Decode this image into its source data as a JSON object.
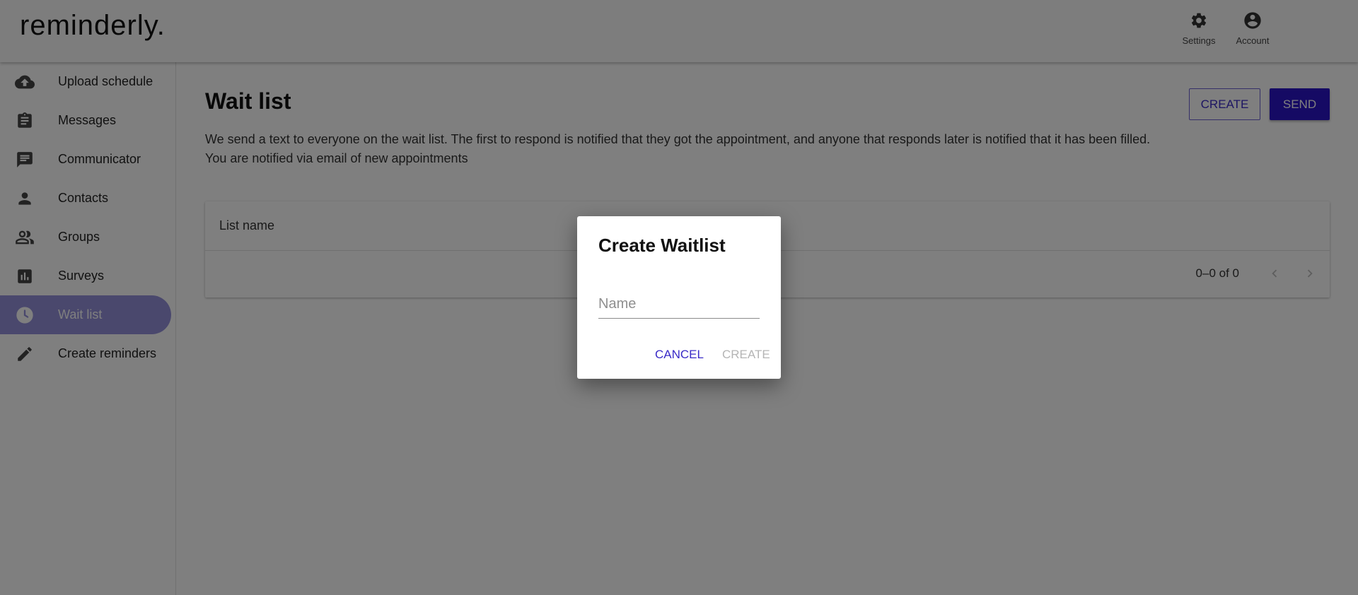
{
  "header": {
    "logo": "reminderly.",
    "actions": [
      {
        "label": "Settings",
        "icon": "gear-icon"
      },
      {
        "label": "Account",
        "icon": "account-circle-icon"
      }
    ]
  },
  "sidebar": {
    "items": [
      {
        "label": "Upload schedule",
        "icon": "cloud-upload-icon",
        "active": false
      },
      {
        "label": "Messages",
        "icon": "clipboard-icon",
        "active": false
      },
      {
        "label": "Communicator",
        "icon": "chat-icon",
        "active": false
      },
      {
        "label": "Contacts",
        "icon": "person-icon",
        "active": false
      },
      {
        "label": "Groups",
        "icon": "people-icon",
        "active": false
      },
      {
        "label": "Surveys",
        "icon": "bar-chart-icon",
        "active": false
      },
      {
        "label": "Wait list",
        "icon": "clock-icon",
        "active": true
      },
      {
        "label": "Create reminders",
        "icon": "pencil-icon",
        "active": false
      }
    ]
  },
  "main": {
    "title": "Wait list",
    "description": "We send a text to everyone on the wait list. The first to respond is notified that they got the appointment, and anyone that responds later is notified that it has been filled. You are notified via email of new appointments",
    "create_label": "CREATE",
    "send_label": "SEND",
    "table": {
      "columns": [
        "List name"
      ],
      "rows": [],
      "pagination": "0–0 of 0"
    }
  },
  "dialog": {
    "title": "Create Waitlist",
    "name_placeholder": "Name",
    "name_value": "",
    "cancel_label": "CANCEL",
    "create_label": "CREATE"
  },
  "colors": {
    "accent": "#2a14c8",
    "active_nav": "#9590db",
    "disabled_text": "#b5b5b5"
  }
}
